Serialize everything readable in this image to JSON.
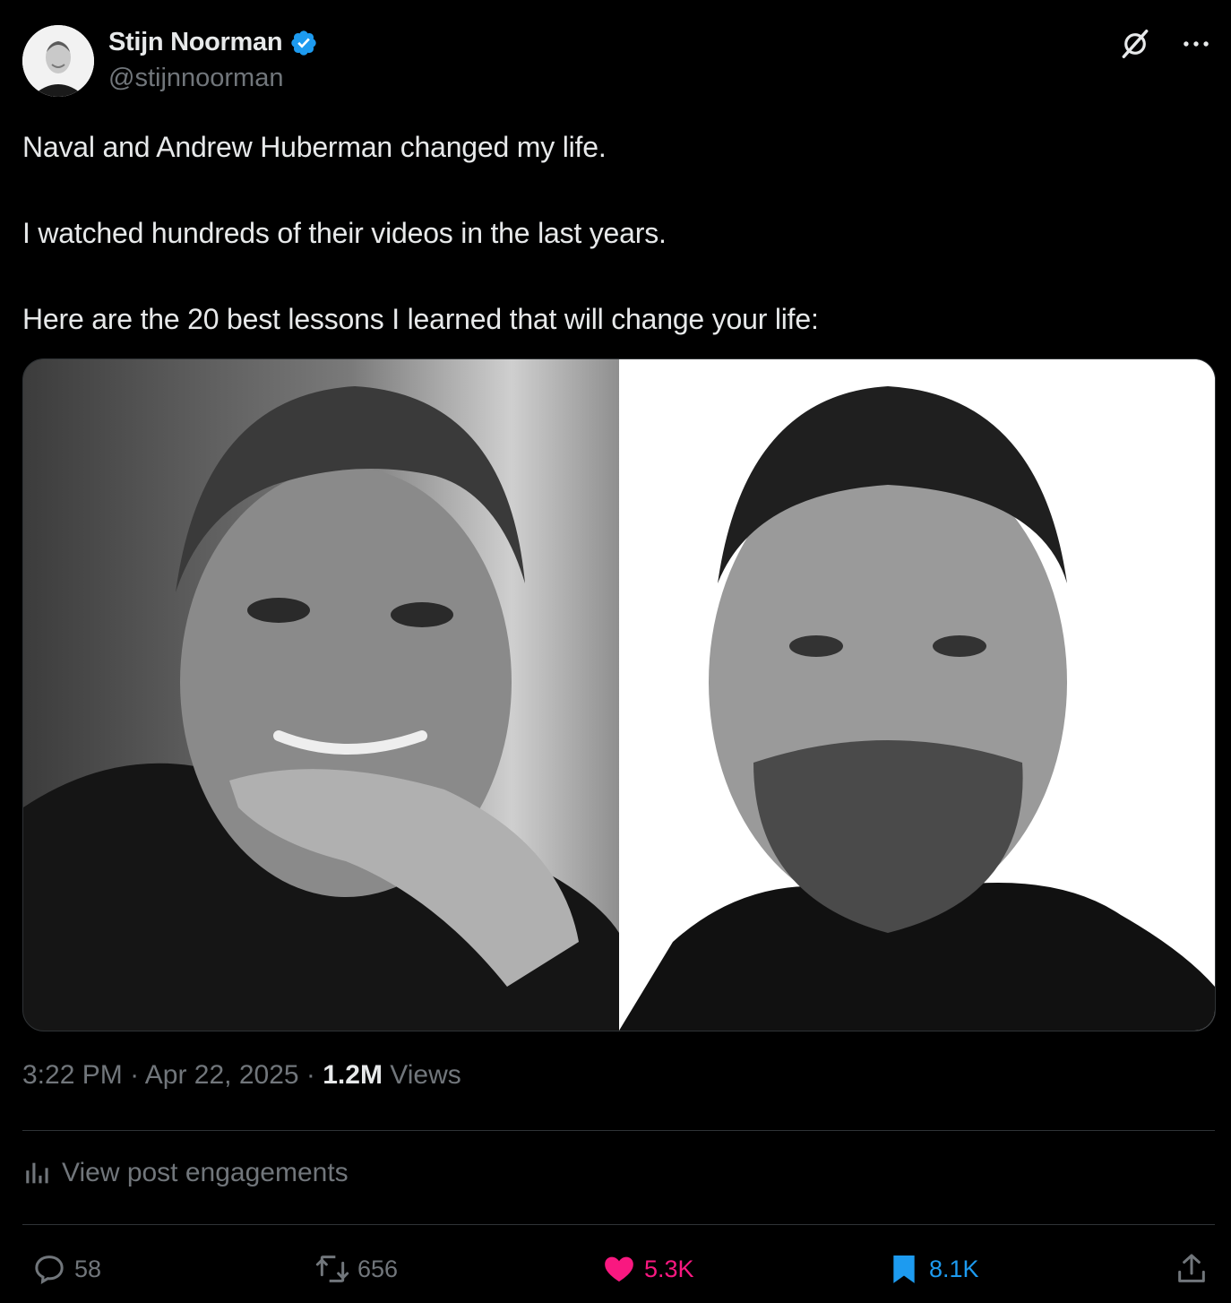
{
  "author": {
    "name": "Stijn Noorman",
    "handle": "@stijnnoorman",
    "verified": true
  },
  "tweet": {
    "paragraphs": [
      "Naval and Andrew Huberman changed my life.",
      "I watched hundreds of their videos in the last years.",
      "Here are the 20 best lessons I learned that will change your life:"
    ]
  },
  "meta": {
    "time": "3:22 PM",
    "separator": "·",
    "date": "Apr 22, 2025",
    "views_count": "1.2M",
    "views_label": "Views"
  },
  "engagements_label": "View post engagements",
  "actions": {
    "replies": "58",
    "reposts": "656",
    "likes": "5.3K",
    "bookmarks": "8.1K"
  },
  "colors": {
    "background": "#000000",
    "text": "#e7e9ea",
    "muted": "#71767b",
    "like": "#f91880",
    "bookmark": "#1d9bf0",
    "verified": "#1d9bf0"
  },
  "icons": [
    "verified-badge-icon",
    "grok-icon",
    "more-icon",
    "analytics-icon",
    "reply-icon",
    "repost-icon",
    "heart-icon",
    "bookmark-icon",
    "share-icon"
  ]
}
